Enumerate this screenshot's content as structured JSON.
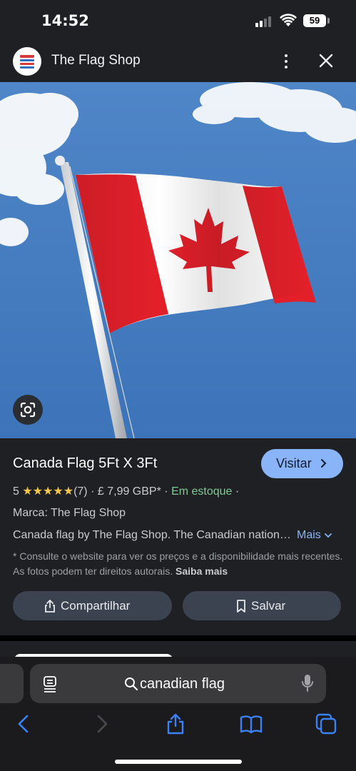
{
  "status_bar": {
    "time": "14:52",
    "battery": "59"
  },
  "header": {
    "site_name": "The Flag Shop"
  },
  "product": {
    "title": "Canada Flag 5Ft X 3Ft",
    "visit_label": "Visitar",
    "rating": "5",
    "stars": "★★★★★",
    "review_count": "(7)",
    "separator": "·",
    "price": "£ 7,99 GBP*",
    "stock": "Em estoque",
    "brand": "Marca: The Flag Shop",
    "description": "Canada flag by The Flag Shop. The Canadian national flag is available in a range of sizes.",
    "more_label": "Mais",
    "note": "* Consulte o website para ver os preços e a disponibilidade mais recentes. As fotos podem ter direitos autorais.",
    "learn_more": "Saiba mais",
    "share_label": "Compartilhar",
    "save_label": "Salvar"
  },
  "browser": {
    "search_query": "canadian flag"
  },
  "colors": {
    "accent": "#8ab4f8",
    "stock": "#81c995",
    "stars": "#f5c64c",
    "flag_red": "#e3202a"
  },
  "icons": [
    "signal-icon",
    "wifi-icon",
    "battery-icon",
    "site-logo-icon",
    "more-vert-icon",
    "close-icon",
    "lens-icon",
    "chevron-right-icon",
    "chevron-down-icon",
    "share-icon",
    "bookmark-icon",
    "reader-icon",
    "search-icon",
    "mic-icon",
    "back-icon",
    "forward-icon",
    "share-sheet-icon",
    "bookmarks-icon",
    "tabs-icon"
  ]
}
